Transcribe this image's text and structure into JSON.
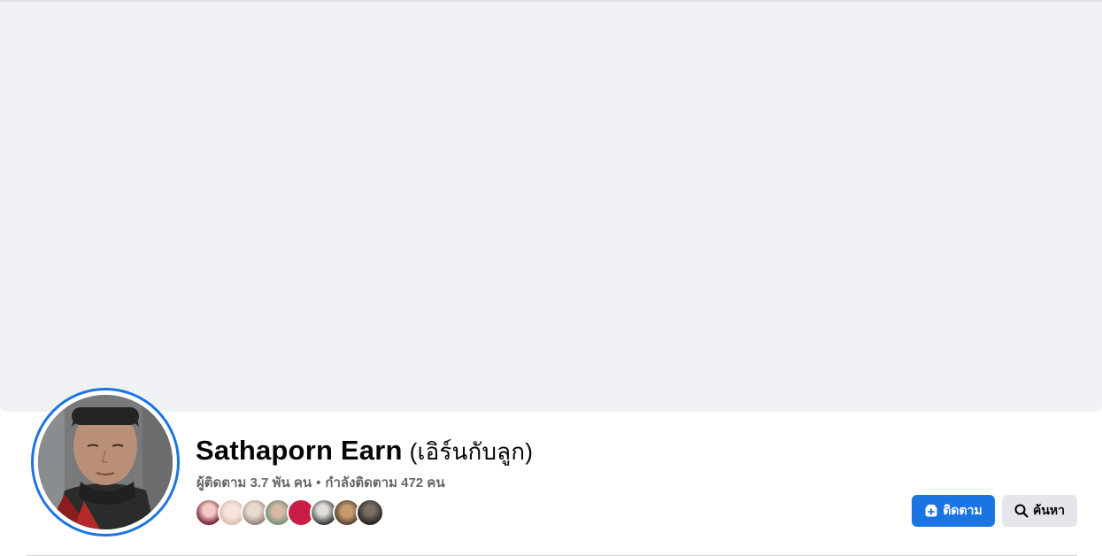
{
  "profile": {
    "name": "Sathaporn Earn",
    "alternate_name": "(เอิร์นกับลูก)",
    "followers": "ผู้ติดตาม 3.7 พัน คน",
    "separator": "•",
    "following": "กำลังติดตาม 472 คน"
  },
  "actions": {
    "follow_label": "ติดตาม",
    "search_label": "ค้นหา"
  },
  "colors": {
    "accent": "#1b74e4",
    "cover": "#eff1f5",
    "secondary_text": "#65676b",
    "secondary_button": "#e4e6eb"
  },
  "icons": {
    "follow": "follow-plus-icon",
    "search": "search-icon"
  }
}
